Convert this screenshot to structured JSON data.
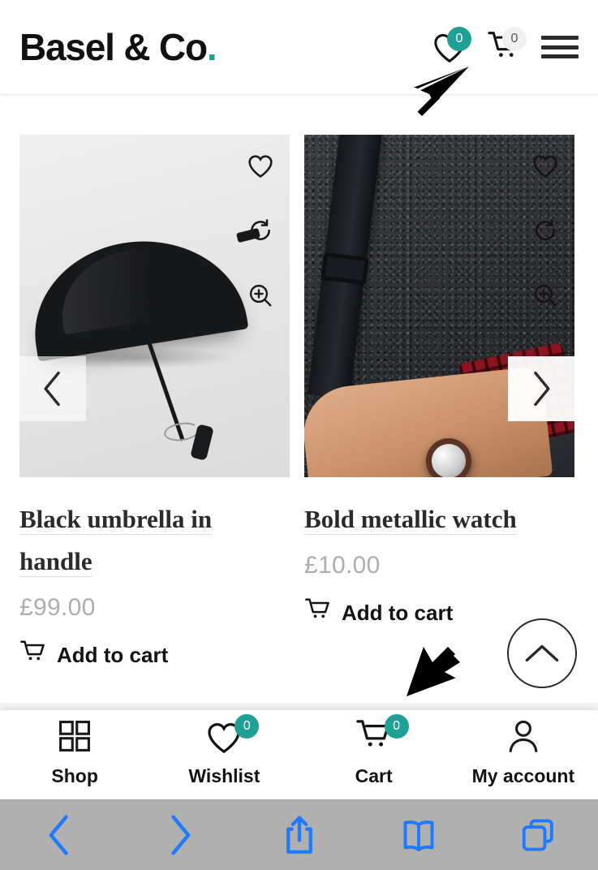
{
  "header": {
    "logo_text": "Basel & Co",
    "logo_dot": ".",
    "wishlist_icon": "heart-icon",
    "wishlist_count": "0",
    "cart_icon": "cart-icon",
    "cart_count": "0",
    "menu_icon": "hamburger-menu-icon",
    "accent_color": "#20a095"
  },
  "catalog": {
    "prev_arrow": "‹",
    "next_arrow": "›",
    "products": [
      {
        "title_line1": "Black umbrella in",
        "title_line2": "handle",
        "price": "£99.00",
        "add_to_cart": "Add to cart",
        "image_alt": "black folding umbrella on light grey background",
        "actions": [
          "wishlist-heart-icon",
          "compare-refresh-icon",
          "quick-view-zoom-icon"
        ]
      },
      {
        "title_line1": "Bold metallic watch",
        "title_line2": "",
        "price": "£10.00",
        "add_to_cart": "Add to cart",
        "image_alt": "man wearing metallic watch with dark grey sweater and backpack strap",
        "actions": [
          "wishlist-heart-icon",
          "compare-refresh-icon",
          "quick-view-zoom-icon"
        ]
      }
    ]
  },
  "scroll_top": {
    "icon": "chevron-up-icon"
  },
  "bottom_nav": {
    "items": [
      {
        "label": "Shop",
        "icon": "grid-icon",
        "badge": ""
      },
      {
        "label": "Wishlist",
        "icon": "heart-icon",
        "badge": "0"
      },
      {
        "label": "Cart",
        "icon": "cart-icon",
        "badge": "0"
      },
      {
        "label": "My account",
        "icon": "person-icon",
        "badge": ""
      }
    ],
    "badge_color": "#20a095"
  },
  "browser_toolbar": {
    "buttons": [
      {
        "name": "back-icon"
      },
      {
        "name": "forward-icon"
      },
      {
        "name": "share-icon"
      },
      {
        "name": "bookmarks-book-icon"
      },
      {
        "name": "tabs-icon"
      }
    ],
    "tint_color": "#1e7bff",
    "background": "#b0b0b0"
  },
  "annotations": {
    "cursor_top": "mouse-cursor-pointer",
    "cursor_bottom": "arrow-pointer-down-left"
  }
}
